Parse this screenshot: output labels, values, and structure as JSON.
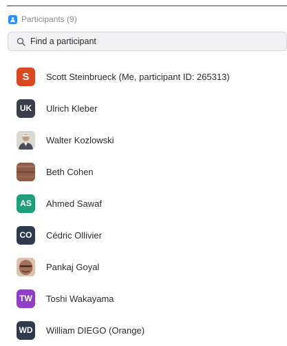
{
  "header": {
    "title": "Participants (9)",
    "icon": "participants-icon",
    "accent": "#2d8cff"
  },
  "search": {
    "placeholder": "Find a participant",
    "icon": "search-icon"
  },
  "participants": [
    {
      "name": "Scott Steinbrueck (Me, participant ID: 265313)",
      "initials": "S",
      "color": "#d9481f"
    },
    {
      "name": "Ulrich Kleber",
      "initials": "UK",
      "color": "#3a3d4a"
    },
    {
      "name": "Walter Kozlowski",
      "initials": "",
      "photo": "photo-avatar"
    },
    {
      "name": "Beth Cohen",
      "initials": "",
      "photo": "photo-avatar"
    },
    {
      "name": "Ahmed Sawaf",
      "initials": "AS",
      "color": "#1f9e7a"
    },
    {
      "name": "Cédric Ollivier",
      "initials": "CO",
      "color": "#2f3a4e"
    },
    {
      "name": "Pankaj Goyal",
      "initials": "",
      "photo": "photo-avatar"
    },
    {
      "name": "Toshi Wakayama",
      "initials": "TW",
      "color": "#8f3fc4"
    },
    {
      "name": "William DIEGO (Orange)",
      "initials": "WD",
      "color": "#2f3a4e"
    }
  ]
}
